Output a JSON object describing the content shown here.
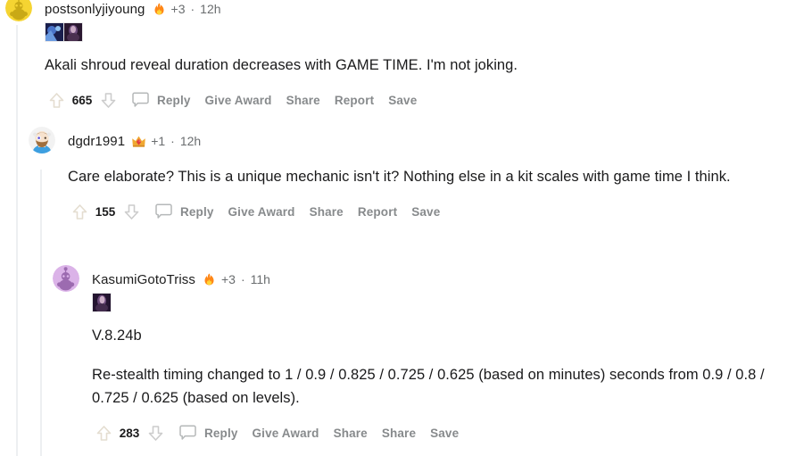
{
  "thread": {
    "comments": [
      {
        "id": "comment-1",
        "username": "postsonlyjiyoung",
        "award_badge_icon": "fire-award-icon",
        "award_badge_color": "#ff8717",
        "award_count": "+3",
        "separator": "·",
        "timestamp": "12h",
        "award_thumbnails": [
          "award-thumbnail-blue",
          "award-thumbnail-purple"
        ],
        "body_paragraphs": [
          "Akali shroud reveal duration decreases with GAME TIME. I'm not joking."
        ],
        "score": "665",
        "actions": {
          "upvote_icon": "upvote-arrow-icon",
          "downvote_icon": "downvote-arrow-icon",
          "comment_icon": "comment-bubble-icon",
          "reply": "Reply",
          "give_award": "Give Award",
          "share": "Share",
          "report": "Report",
          "save": "Save"
        }
      },
      {
        "id": "comment-2",
        "username": "dgdr1991",
        "award_badge_icon": "gem-crown-award-icon",
        "award_badge_color": "#e03c3c",
        "award_count": "+1",
        "separator": "·",
        "timestamp": "12h",
        "award_thumbnails": [],
        "body_paragraphs": [
          "Care elaborate? This is a unique mechanic isn't it? Nothing else in a kit scales with game time I think."
        ],
        "score": "155",
        "actions": {
          "upvote_icon": "upvote-arrow-icon",
          "downvote_icon": "downvote-arrow-icon",
          "comment_icon": "comment-bubble-icon",
          "reply": "Reply",
          "give_award": "Give Award",
          "share": "Share",
          "report": "Report",
          "save": "Save"
        }
      },
      {
        "id": "comment-3",
        "username": "KasumiGotoTriss",
        "award_badge_icon": "fire-award-icon",
        "award_badge_color": "#ff8717",
        "award_count": "+3",
        "separator": "·",
        "timestamp": "11h",
        "award_thumbnails": [
          "award-thumbnail-purple"
        ],
        "body_paragraphs": [
          "V.8.24b",
          "Re-stealth timing changed to 1 / 0.9 / 0.825 / 0.725 / 0.625 (based on minutes) seconds from 0.9 / 0.8 / 0.725 / 0.625 (based on levels)."
        ],
        "score": "283",
        "actions": {
          "upvote_icon": "upvote-arrow-icon",
          "downvote_icon": "downvote-arrow-icon",
          "comment_icon": "comment-bubble-icon",
          "reply": "Reply",
          "give_award": "Give Award",
          "share": "Share",
          "report": "Share",
          "save": "Save"
        }
      }
    ],
    "colors": {
      "background": "#ffffff",
      "text": "#1a1a1b",
      "meta_text": "#6a6d6f",
      "action_text": "#878a8c",
      "threadline": "#edeff1",
      "upvote_arrow": "#e4ddd0",
      "downvote_arrow": "#cccccc"
    }
  }
}
